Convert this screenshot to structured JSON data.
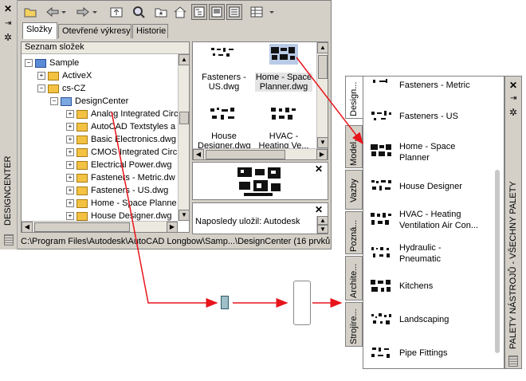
{
  "designcenter": {
    "title": "DESIGNCENTER",
    "tabs": [
      "Složky",
      "Otevřené výkresy",
      "Historie"
    ],
    "tree": {
      "header": "Seznam složek",
      "nodes": [
        {
          "label": "Sample",
          "expander": "−"
        },
        {
          "label": "ActiveX",
          "expander": "+"
        },
        {
          "label": "cs-CZ",
          "expander": "−"
        },
        {
          "label": "DesignCenter",
          "expander": "−"
        },
        {
          "label": "Analog Integrated Circ",
          "expander": "+"
        },
        {
          "label": "AutoCAD Textstyles a",
          "expander": "+"
        },
        {
          "label": "Basic Electronics.dwg",
          "expander": "+"
        },
        {
          "label": "CMOS Integrated Circ",
          "expander": "+"
        },
        {
          "label": "Electrical Power.dwg",
          "expander": "+"
        },
        {
          "label": "Fasteners - Metric.dw",
          "expander": "+"
        },
        {
          "label": "Fasteners - US.dwg",
          "expander": "+"
        },
        {
          "label": "Home - Space Planne",
          "expander": "+"
        },
        {
          "label": "House Designer.dwg",
          "expander": "+"
        }
      ]
    },
    "content_items": [
      {
        "label": "Fasteners -\nUS.dwg"
      },
      {
        "label": "Home - Space\nPlanner.dwg"
      },
      {
        "label": "House\nDesigner.dwg"
      },
      {
        "label": "HVAC -\nHeating Ve..."
      }
    ],
    "description": "Naposledy uložil: Autodesk",
    "status_path": "C:\\Program Files\\Autodesk\\AutoCAD Longbow\\Samp...\\DesignCenter (16 prvků)"
  },
  "tool_palettes": {
    "title": "PALETY NÁSTROJŮ - VŠECHNY PALETY",
    "tabs": [
      "Design...",
      "Model...",
      "Vazby",
      "Pozná...",
      "Archite...",
      "Strojíre..."
    ],
    "items": [
      "Fasteners - Metric",
      "Fasteners - US",
      "Home - Space\nPlanner",
      "House Designer",
      "HVAC - Heating\nVentilation Air Con...",
      "Hydraulic -\nPneumatic",
      "Kitchens",
      "Landscaping",
      "Pipe Fittings"
    ]
  },
  "colors": {
    "arrow": "#e8141c",
    "folder": "#f4c242",
    "panel": "#d4d0c8"
  }
}
